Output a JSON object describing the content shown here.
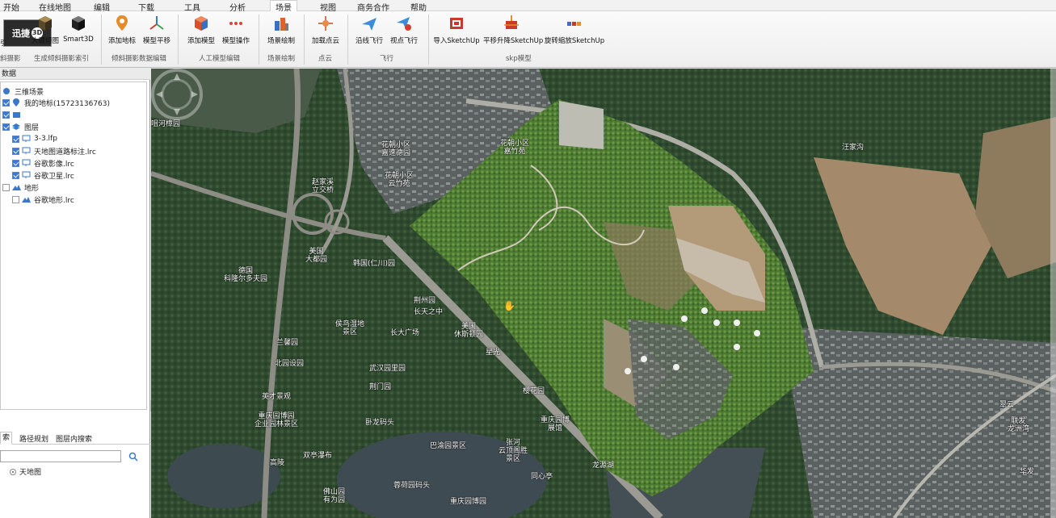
{
  "menu": [
    "开始",
    "在线地图",
    "编辑",
    "下载",
    "工具",
    "分析",
    "场景",
    "视图",
    "商务合作",
    "帮助"
  ],
  "menu_active": "场景",
  "logo": {
    "text": "迅捷",
    "badge": "3D"
  },
  "ribbon": {
    "partial_left": "引",
    "buttons": {
      "da_qing_xie": "大疆倾图",
      "smart3d": "Smart3D",
      "add_landmark": "添加地标",
      "model_pan": "模型平移",
      "add_model": "添加模型",
      "model_ops": "模型操作",
      "scene_draw": "场景绘制",
      "load_pointcloud": "加载点云",
      "fly_along": "沿线飞行",
      "viewpoint_fly": "视点飞行",
      "import_sketchup": "导入SketchUp",
      "pan_lift_sketchup": "平移升降SketchUp",
      "rotate_scale_sketchup": "旋转缩放SketchUp"
    },
    "groups": {
      "g0": "斜摄影",
      "g1": "生成倾斜摄影索引",
      "g2": "倾斜摄影数据编辑",
      "g3": "人工模型编辑",
      "g4": "场景绘制",
      "g5": "点云",
      "g6": "飞行",
      "g7": "skp模型"
    }
  },
  "left_panel": {
    "title": "数据",
    "tree": [
      {
        "label": "三维场景",
        "checked": null,
        "icon": "scene-icon"
      },
      {
        "label": "我的地标(15723136763)",
        "checked": true,
        "icon": "pin-icon"
      },
      {
        "label": "",
        "checked": true,
        "icon": "folder-icon"
      },
      {
        "label": "图层",
        "checked": true,
        "icon": "layers-icon"
      },
      {
        "label": "3-3.lfp",
        "checked": true,
        "icon": "monitor-icon"
      },
      {
        "label": "天地图道路标注.lrc",
        "checked": true,
        "icon": "monitor-icon"
      },
      {
        "label": "谷歌影像.lrc",
        "checked": true,
        "icon": "monitor-icon"
      },
      {
        "label": "谷歌卫星.lrc",
        "checked": true,
        "icon": "monitor-icon"
      },
      {
        "label": "地形",
        "checked": false,
        "icon": "terrain-icon"
      },
      {
        "label": "谷歌地形.lrc",
        "checked": false,
        "icon": "terrain-icon"
      }
    ],
    "tabs": [
      "索",
      "路径规划",
      "图层内搜索"
    ],
    "search_value": "",
    "radio_label": "天地图"
  },
  "map": {
    "labels": {
      "l1": "咀河樟园",
      "l2": "花朝小区\n嘉速德园",
      "l3": "花朝小区\n嘉竹苑",
      "l4": "花朝小区\n云竹苑",
      "l5": "赵家溪\n立交桥",
      "l6": "美国\n大都园",
      "l7": "韩国(仁川)园",
      "l8": "德国\n科隆尔多夫园",
      "l9": "荆州园",
      "l10": "长天之中",
      "l11": "侯鸟湿地\n景区",
      "l12": "长大广场",
      "l13": "美国\n休斯顿园",
      "l14": "兰馨园",
      "l15": "北园设园",
      "l16": "武汉园里园",
      "l17": "荆门园",
      "l18": "星光",
      "l19": "樱花园",
      "l20": "英才景观",
      "l21": "重庆园博园\n企业园林景区",
      "l22": "卧龙码头",
      "l23": "重庆园博\n展馆",
      "l24": "巴渝园景区",
      "l25": "张河\n云顶阁胜\n景区",
      "l26": "高陵",
      "l27": "双亭瀑布",
      "l28": "龙源湖",
      "l29": "同心亭",
      "l30": "蓉荷园码头",
      "l31": "佛山园\n有为园",
      "l32": "重庆园博园",
      "l33": "汪家沟",
      "l34": "翠云",
      "l35": "联发\n龙洲湾",
      "l36": "华发"
    }
  }
}
